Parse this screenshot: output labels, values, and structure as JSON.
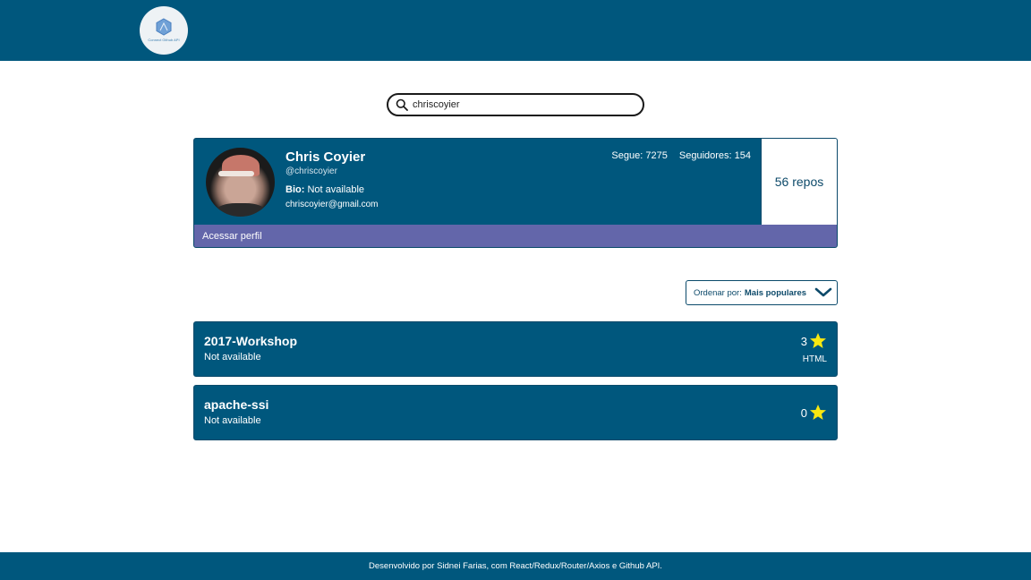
{
  "header": {
    "logo_text": "Connect Github API"
  },
  "search": {
    "value": "chriscoyier",
    "placeholder": ""
  },
  "profile": {
    "name": "Chris Coyier",
    "login": "@chriscoyier",
    "bio_label": "Bio:",
    "bio_value": "Not available",
    "email": "chriscoyier@gmail.com",
    "following": "Segue: 7275",
    "followers": "Seguidores: 154",
    "repos": "56 repos",
    "link_label": "Acessar perfil"
  },
  "sort": {
    "label": "Ordenar por:",
    "value": "Mais populares"
  },
  "repos": [
    {
      "name": "2017-Workshop",
      "description": "Not available",
      "stars": "3",
      "language": "HTML"
    },
    {
      "name": "apache-ssi",
      "description": "Not available",
      "stars": "0",
      "language": ""
    }
  ],
  "footer": {
    "text": "Desenvolvido por Sidnei Farias, com React/Redux/Router/Axios e Github API."
  },
  "colors": {
    "primary": "#00577d",
    "accent": "#6366aa",
    "star": "#f7e711"
  },
  "icons": {
    "search": "search-icon",
    "star": "star-icon",
    "dropdown": "chevron-down-icon",
    "logo": "hexagon-logo-icon"
  }
}
